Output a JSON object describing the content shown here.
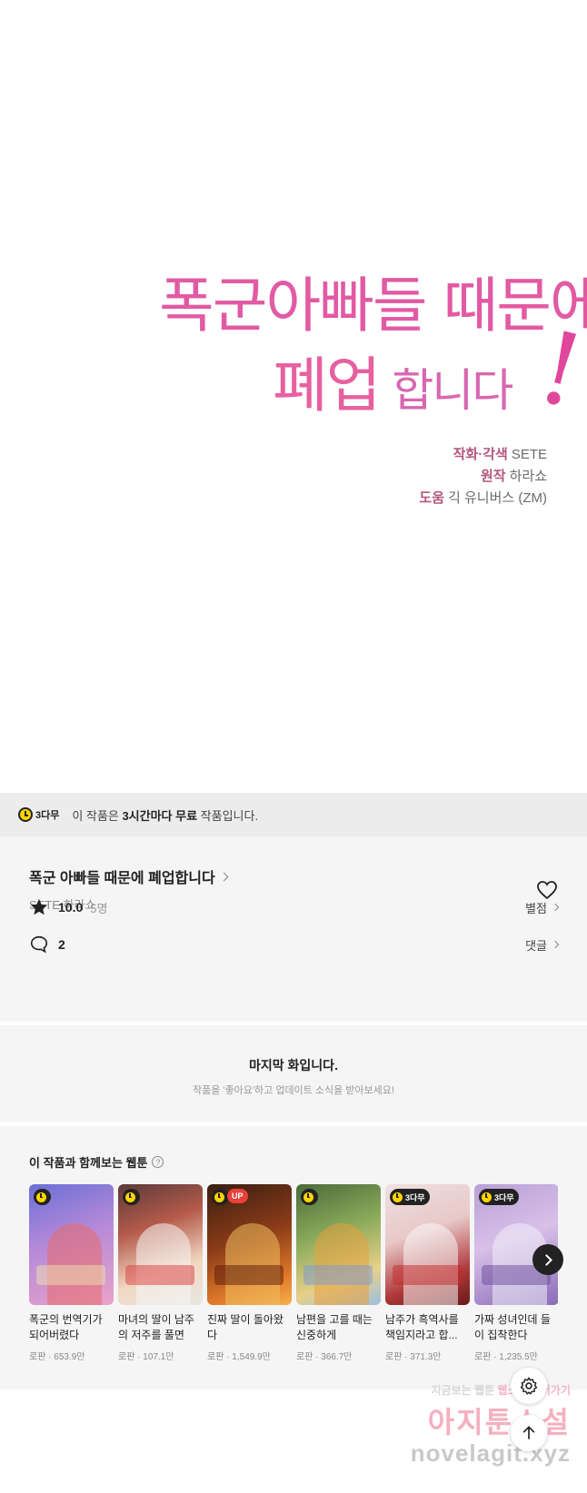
{
  "panel": {
    "logo_line1": "폭군아빠들 때문에",
    "logo_line2_big": "폐업",
    "logo_line2_small": " 합니다",
    "logo_bang": "!",
    "credits": [
      {
        "role": "작화·각색",
        "name": "SETE"
      },
      {
        "role": "원작",
        "name": "하라쇼"
      },
      {
        "role": "도움",
        "name": "긱 유니버스 (ZM)"
      }
    ]
  },
  "free_bar": {
    "badge": "3다무",
    "text_pre": "이 작품은 ",
    "text_bold": "3시간마다 무료",
    "text_post": " 작품입니다."
  },
  "info": {
    "title": "폭군 아빠들 때문에 폐업합니다",
    "author": "SETE,하라쇼",
    "rating": "10.0",
    "rating_count": "5명",
    "rating_link": "별점",
    "comment_count": "2",
    "comment_link": "댓글"
  },
  "last": {
    "title": "마지막 화입니다.",
    "subtitle": "작품을 '좋아요'하고 업데이트 소식을 받아보세요!"
  },
  "recommend": {
    "title": "이 작품과 함께보는 웹툰",
    "help": "?",
    "items": [
      {
        "name": "폭군의 번역기가 되어버렸다",
        "meta": "로판 · 653.9만",
        "badge": "",
        "up": "",
        "bg": "linear-gradient(160deg,#6b6fd6 0%,#b58ad8 45%,#e9a3c8 100%)",
        "c1": "#e86a6a",
        "c2": "#f0e2b0"
      },
      {
        "name": "마녀의 딸이 남주의 저주를 풀면",
        "meta": "로판 · 107.1만",
        "badge": "",
        "up": "",
        "bg": "linear-gradient(160deg,#5a3a3a 0%,#b45a4a 35%,#f2d7c2 70%,#e8e8e0 100%)",
        "c1": "#f5f5f5",
        "c2": "#d93b3b"
      },
      {
        "name": "진짜 딸이 돌아왔다",
        "meta": "로판 · 1,549.9만",
        "badge": "",
        "up": "UP",
        "bg": "linear-gradient(160deg,#3a1f12 0%,#8a3b18 45%,#e07a2a 80%,#f5b04a 100%)",
        "c1": "#f0c060",
        "c2": "#5a1a0a"
      },
      {
        "name": "남편을 고를 때는 신중하게",
        "meta": "로판 · 366.7만",
        "badge": "",
        "up": "",
        "bg": "linear-gradient(160deg,#4a6a3a 0%,#8aaa5a 40%,#e8d08a 75%,#9ac0e0 100%)",
        "c1": "#e8a040",
        "c2": "#7a9ad0"
      },
      {
        "name": "남주가 흑역사를 책임지라고 합...",
        "meta": "로판 · 371.3만",
        "badge": "3다무",
        "up": "",
        "bg": "linear-gradient(160deg,#f0e0e0 0%,#e8c8c8 40%,#b03a3a 75%,#6a1a1a 100%)",
        "c1": "#f8f8f8",
        "c2": "#c22a2a"
      },
      {
        "name": "가짜 성녀인데 들이 집착한다",
        "meta": "로판 · 1,235.5만",
        "badge": "3다무",
        "up": "",
        "bg": "linear-gradient(160deg,#b8a0d8 0%,#d8c0e8 45%,#8a6ab8 100%)",
        "c1": "#f0f0f8",
        "c2": "#6a4a9a"
      }
    ]
  },
  "watermark": {
    "line1_gray": "지금보는 ",
    "line1_mid": "웹툰 ",
    "line1_pink": "웹소설 보러가기",
    "line2": "아지툰소설",
    "line3": "novelagit.xyz"
  }
}
